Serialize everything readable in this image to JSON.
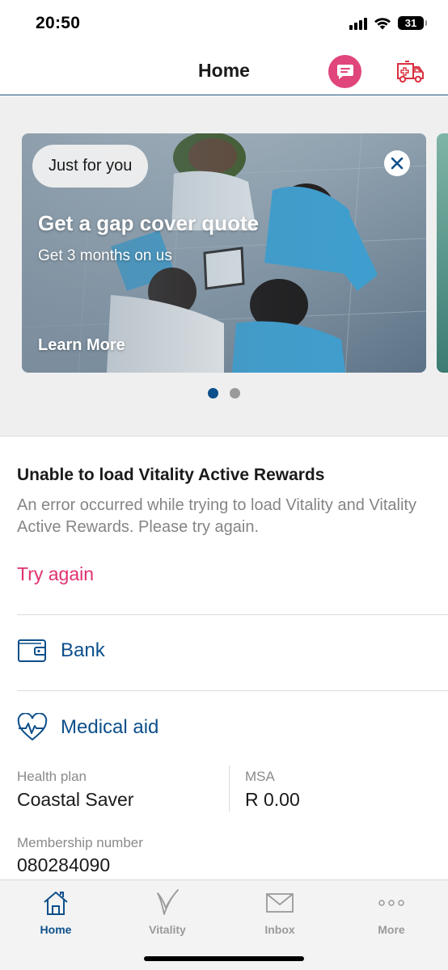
{
  "status_bar": {
    "time": "20:50",
    "battery": "31"
  },
  "header": {
    "title": "Home",
    "chat_icon": "chat-bubble-icon",
    "emergency_icon": "ambulance-icon"
  },
  "promo": {
    "badge": "Just for you",
    "title": "Get a gap cover quote",
    "subtitle": "Get 3 months on us",
    "link": "Learn More",
    "close_icon": "close-icon",
    "page_count": 2,
    "active_page": 1
  },
  "vitality_error": {
    "title": "Unable to load Vitality Active Rewards",
    "message": "An error occurred while trying to load Vitality and Vitality Active Rewards. Please try again.",
    "retry": "Try again"
  },
  "bank": {
    "label": "Bank",
    "icon": "wallet-icon"
  },
  "medical_aid": {
    "label": "Medical aid",
    "icon": "heart-pulse-icon",
    "health_plan_label": "Health plan",
    "health_plan_value": "Coastal Saver",
    "msa_label": "MSA",
    "msa_value": "R 0.00",
    "membership_label": "Membership number",
    "membership_value": "080284090"
  },
  "tabs": [
    {
      "label": "Home",
      "icon": "home-icon",
      "active": true
    },
    {
      "label": "Vitality",
      "icon": "vitality-icon",
      "active": false
    },
    {
      "label": "Inbox",
      "icon": "mail-icon",
      "active": false
    },
    {
      "label": "More",
      "icon": "more-dots-icon",
      "active": false
    }
  ],
  "colors": {
    "brand_blue": "#0d4f8b",
    "accent_pink": "#e0306f",
    "chat_pink": "#e0457b"
  }
}
